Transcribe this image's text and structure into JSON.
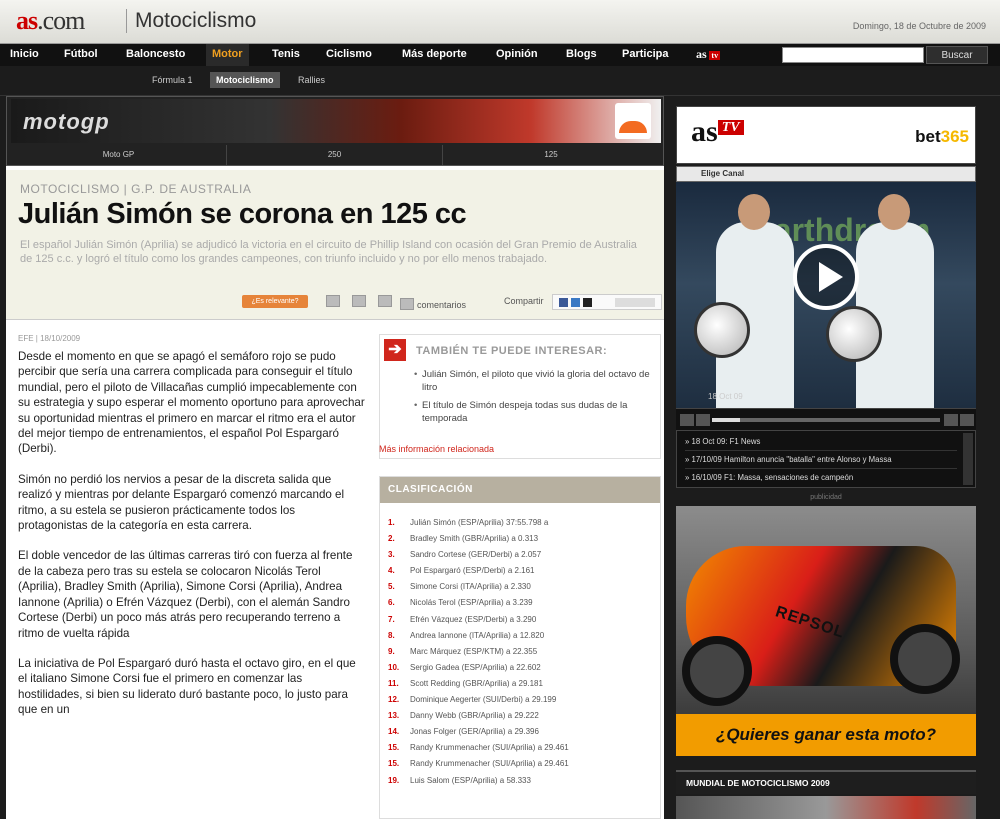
{
  "header": {
    "logo": "as",
    "logo_suffix": ".com",
    "section": "Motociclismo",
    "date": "Domingo, 18 de Octubre de 2009"
  },
  "nav": {
    "items": [
      "Inicio",
      "Fútbol",
      "Baloncesto",
      "Motor",
      "Tenis",
      "Ciclismo",
      "Más deporte",
      "Opinión",
      "Blogs",
      "Participa"
    ],
    "active": "Motor",
    "astv": "as",
    "astv_badge": "tv",
    "search_placeholder": "",
    "search_button": "Buscar"
  },
  "subnav": {
    "items": [
      "Fórmula 1",
      "Motociclismo",
      "Rallies"
    ],
    "active": "Motociclismo"
  },
  "motogp": {
    "logo": "motogp",
    "tabs": [
      "Moto GP",
      "250",
      "125"
    ]
  },
  "article": {
    "kicker": "MOTOCICLISMO | G.P. DE AUSTRALIA",
    "headline": "Julián Simón se corona en 125 cc",
    "lead": "El español Julián Simón (Aprilia) se adjudicó la victoria en el circuito de Phillip Island con ocasión del Gran Premio de Australia de 125 c.c. y logró el título como los grandes campeones, con triunfo incluido y no por ello menos trabajado.",
    "tools": {
      "badge": "¿Es relevante?",
      "comments": "comentarios",
      "share": "Compartir"
    },
    "byline": "EFE | 18/10/2009",
    "paragraphs": [
      "Desde el momento en que se apagó el semáforo rojo se pudo percibir que sería una carrera complicada para conseguir el título mundial, pero el piloto de Villacañas cumplió impecablemente con su estrategia y supo esperar el momento oportuno para aprovechar su oportunidad mientras el primero en marcar el ritmo era el autor del mejor tiempo de entrenamientos, el español Pol Espargaró (Derbi).",
      "Simón no perdió los nervios a pesar de la discreta salida que realizó y mientras por delante Espargaró comenzó marcando el ritmo, a su estela se pusieron prácticamente todos los protagonistas de la categoría en esta carrera.",
      "El doble vencedor de las últimas carreras tiró con fuerza al frente de la cabeza pero tras su estela se colocaron Nicolás Terol (Aprilia), Bradley Smith (Aprilia), Simone Corsi (Aprilia), Andrea Iannone (Aprilia) o Efrén Vázquez (Derbi), con el alemán Sandro Cortese (Derbi) un poco más atrás pero recuperando terreno a ritmo de vuelta rápida",
      "La iniciativa de Pol Espargaró duró hasta el octavo giro, en el que el italiano Simone Corsi fue el primero en comenzar las hostilidades, si bien su liderato duró bastante poco, lo justo para que en un"
    ]
  },
  "related": {
    "title": "TAMBIÉN TE PUEDE INTERESAR:",
    "items": [
      "Julián Simón, el piloto que vivió la gloria del octavo de litro",
      "El título de Simón despeja todas sus dudas de la temporada"
    ],
    "more": "Más información relacionada"
  },
  "clasificacion": {
    "title": "CLASIFICACIÓN",
    "rows": [
      {
        "pos": "1.",
        "text": "Julián Simón (ESP/Aprilia) 37:55.798 a"
      },
      {
        "pos": "2.",
        "text": "Bradley Smith (GBR/Aprilia) a 0.313"
      },
      {
        "pos": "3.",
        "text": "Sandro Cortese (GER/Derbi) a 2.057"
      },
      {
        "pos": "4.",
        "text": "Pol Espargaró (ESP/Derbi) a 2.161"
      },
      {
        "pos": "5.",
        "text": "Simone Corsi (ITA/Aprilia) a 2.330"
      },
      {
        "pos": "6.",
        "text": "Nicolás Terol (ESP/Aprilia) a 3.239"
      },
      {
        "pos": "7.",
        "text": "Efrén Vázquez (ESP/Derbi) a 3.290"
      },
      {
        "pos": "8.",
        "text": "Andrea Iannone (ITA/Aprilia) a 12.820"
      },
      {
        "pos": "9.",
        "text": "Marc Márquez (ESP/KTM) a 22.355"
      },
      {
        "pos": "10.",
        "text": "Sergio Gadea (ESP/Aprilia) a 22.602"
      },
      {
        "pos": "11.",
        "text": "Scott Redding (GBR/Aprilia) a 29.181"
      },
      {
        "pos": "12.",
        "text": "Dominique Aegerter (SUI/Derbi) a 29.199"
      },
      {
        "pos": "13.",
        "text": "Danny Webb (GBR/Aprilia) a 29.222"
      },
      {
        "pos": "14.",
        "text": "Jonas Folger (GER/Aprilia) a 29.396"
      },
      {
        "pos": "15.",
        "text": "Randy Krummenacher (SUI/Aprilia) a 29.461"
      },
      {
        "pos": "15.",
        "text": "Randy Krummenacher (SUI/Aprilia) a 29.461"
      },
      {
        "pos": "19.",
        "text": "Luis Salom (ESP/Aprilia) a 58.333"
      }
    ]
  },
  "astv": {
    "logo": "as",
    "badge": "TV",
    "sponsor_a": "bet",
    "sponsor_b": "365",
    "channel": "Elige Canal",
    "video_caption": "18 Oct 09",
    "video_text": "earthdream",
    "playlist": [
      "» 18 Oct 09: F1 News",
      "» 17/10/09 Hamilton anuncia \"batalla\" entre Alonso y Massa",
      "» 16/10/09 F1: Massa, sensaciones de campeón"
    ]
  },
  "ad": {
    "label": "publicidad",
    "brand": "REPSOL",
    "cta": "¿Quieres ganar esta moto?"
  },
  "mundial": {
    "title": "MUNDIAL DE MOTOCICLISMO 2009"
  },
  "colors": {
    "accent": "#c00000",
    "nav_active": "#f0a020",
    "cta": "#f29c00"
  }
}
